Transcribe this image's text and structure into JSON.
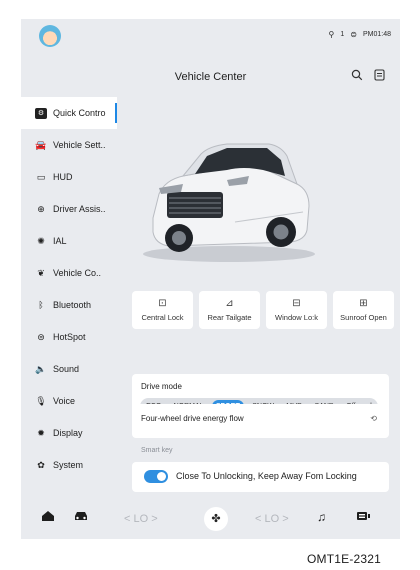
{
  "status_bar": {
    "signal": "1",
    "time": "PM01:48"
  },
  "header": {
    "title": "Vehicle Center"
  },
  "sidebar": {
    "items": [
      {
        "label": "Quick Contro",
        "icon": "quick-control-icon",
        "active": true
      },
      {
        "label": "Vehicle Sett..",
        "icon": "car-icon"
      },
      {
        "label": "HUD",
        "icon": "hud-icon"
      },
      {
        "label": "Driver Assis..",
        "icon": "steering-wheel-icon"
      },
      {
        "label": "IAL",
        "icon": "ambient-light-icon"
      },
      {
        "label": "Vehicle Co..",
        "icon": "leaf-icon"
      },
      {
        "label": "Bluetooth",
        "icon": "bluetooth-icon"
      },
      {
        "label": "HotSpot",
        "icon": "hotspot-icon"
      },
      {
        "label": "Sound",
        "icon": "speaker-icon"
      },
      {
        "label": "Voice",
        "icon": "microphone-icon"
      },
      {
        "label": "Display",
        "icon": "brightness-icon"
      },
      {
        "label": "System",
        "icon": "gear-icon"
      }
    ]
  },
  "quick_tiles": [
    {
      "label": "Central Lock",
      "icon": "central-lock-icon"
    },
    {
      "label": "Rear Tailgate",
      "icon": "tailgate-icon"
    },
    {
      "label": "Window Lo:k",
      "icon": "window-lock-icon"
    },
    {
      "label": "Sunroof Open",
      "icon": "sunroof-icon"
    }
  ],
  "drive_mode": {
    "title": "Drive mode",
    "options": [
      "ECO",
      "NORMAL",
      "SPORT",
      "SNOW",
      "MUD",
      "SAND",
      "Off-road"
    ],
    "selected": "SPORT",
    "energy_flow_label": "Four-wheel drive energy flow"
  },
  "smart_key": {
    "section_label": "Smart key",
    "toggle_label": "Close To Unlocking, Keep Away Fom Locking",
    "enabled": true
  },
  "dock": {
    "left_temp": "< LO >",
    "right_temp": "< LO >"
  },
  "caption": "OMT1E-2321",
  "colors": {
    "accent": "#2f8fe0",
    "background": "#e9ebef"
  }
}
